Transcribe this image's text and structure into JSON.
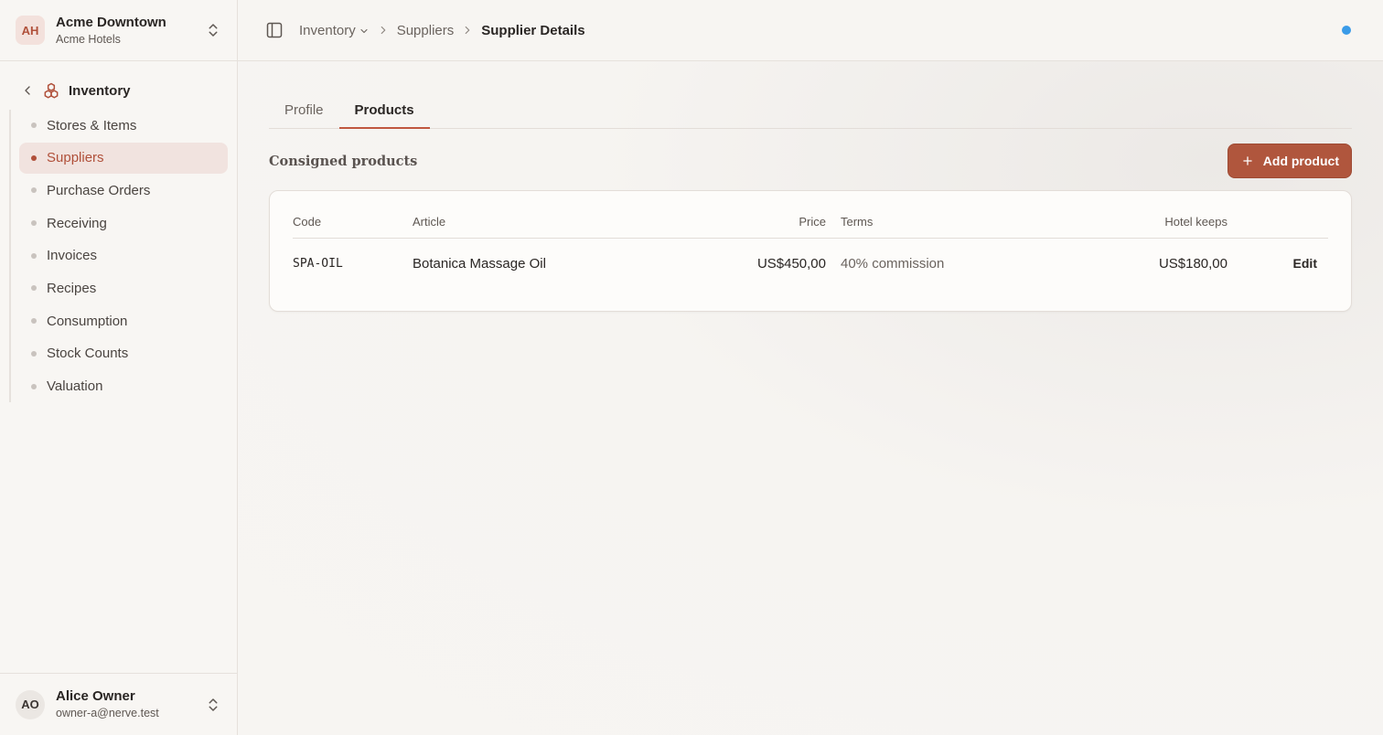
{
  "org": {
    "initials": "AH",
    "name": "Acme Downtown",
    "subtitle": "Acme Hotels"
  },
  "nav": {
    "section": "Inventory",
    "items": [
      {
        "label": "Stores & Items",
        "active": false
      },
      {
        "label": "Suppliers",
        "active": true
      },
      {
        "label": "Purchase Orders",
        "active": false
      },
      {
        "label": "Receiving",
        "active": false
      },
      {
        "label": "Invoices",
        "active": false
      },
      {
        "label": "Recipes",
        "active": false
      },
      {
        "label": "Consumption",
        "active": false
      },
      {
        "label": "Stock Counts",
        "active": false
      },
      {
        "label": "Valuation",
        "active": false
      }
    ]
  },
  "user": {
    "initials": "AO",
    "name": "Alice Owner",
    "email": "owner-a@nerve.test"
  },
  "breadcrumb": {
    "first": "Inventory",
    "second": "Suppliers",
    "current": "Supplier Details"
  },
  "tabs": [
    {
      "label": "Profile"
    },
    {
      "label": "Products"
    }
  ],
  "section": {
    "title": "Consigned products",
    "add_label": "Add product"
  },
  "table": {
    "headers": {
      "code": "Code",
      "article": "Article",
      "price": "Price",
      "terms": "Terms",
      "keeps": "Hotel keeps"
    },
    "rows": [
      {
        "code": "SPA-OIL",
        "article": "Botanica Massage Oil",
        "price": "US$450,00",
        "terms": "40% commission",
        "keeps": "US$180,00",
        "action": "Edit"
      }
    ]
  },
  "colors": {
    "accent": "#b0563d",
    "status_dot": "#3a9be8"
  }
}
